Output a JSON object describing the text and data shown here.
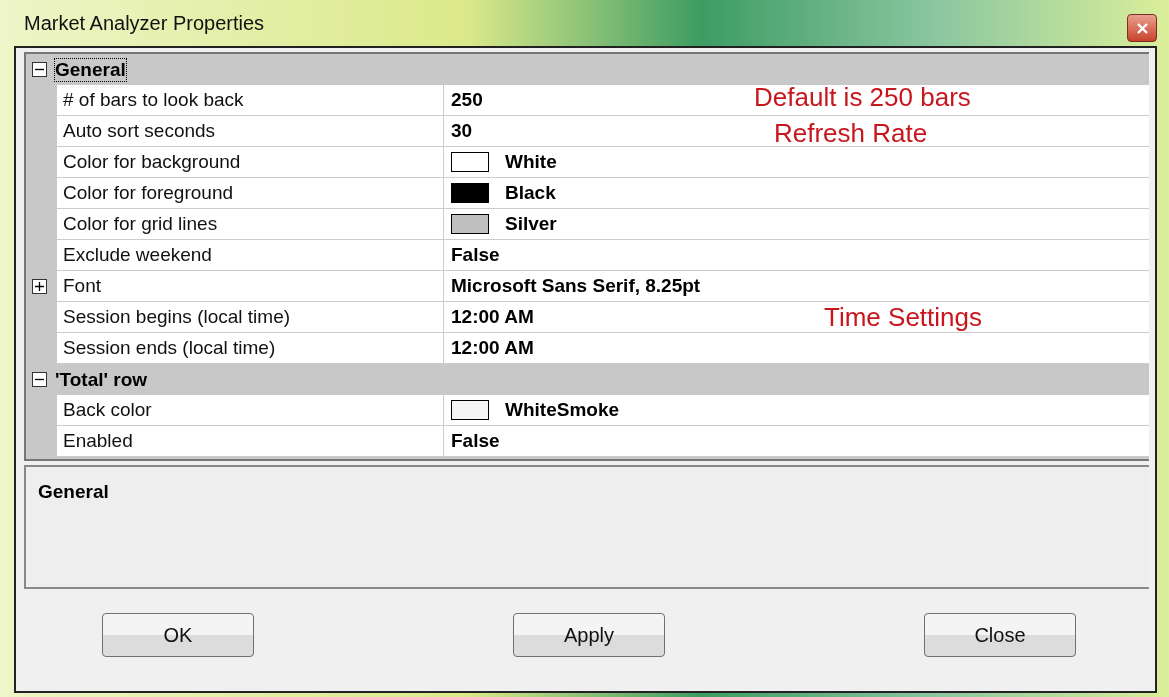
{
  "window": {
    "title": "Market Analyzer Properties"
  },
  "categories": [
    {
      "name": "General",
      "expanded": true,
      "selected": true,
      "properties": [
        {
          "label": "# of bars to look back",
          "value": "250",
          "kind": "text",
          "note": "Default is 250 bars"
        },
        {
          "label": "Auto sort seconds",
          "value": "30",
          "kind": "text",
          "note": "Refresh Rate"
        },
        {
          "label": "Color for background",
          "value": "White",
          "kind": "color",
          "color": "#ffffff"
        },
        {
          "label": "Color for foreground",
          "value": "Black",
          "kind": "color",
          "color": "#000000"
        },
        {
          "label": "Color for grid lines",
          "value": "Silver",
          "kind": "color",
          "color": "#c0c0c0"
        },
        {
          "label": "Exclude weekend",
          "value": "False",
          "kind": "text"
        },
        {
          "label": "Font",
          "value": "Microsoft Sans Serif, 8.25pt",
          "kind": "group",
          "expanded": false
        },
        {
          "label": "Session begins (local time)",
          "value": "12:00 AM",
          "kind": "text",
          "note": "Time Settings"
        },
        {
          "label": "Session ends (local time)",
          "value": "12:00 AM",
          "kind": "text"
        }
      ]
    },
    {
      "name": "'Total' row",
      "expanded": true,
      "selected": false,
      "properties": [
        {
          "label": "Back color",
          "value": "WhiteSmoke",
          "kind": "color",
          "color": "#f5f5f5"
        },
        {
          "label": "Enabled",
          "value": "False",
          "kind": "text"
        }
      ]
    }
  ],
  "description": {
    "title": "General"
  },
  "buttons": [
    "OK",
    "Apply",
    "Close"
  ]
}
